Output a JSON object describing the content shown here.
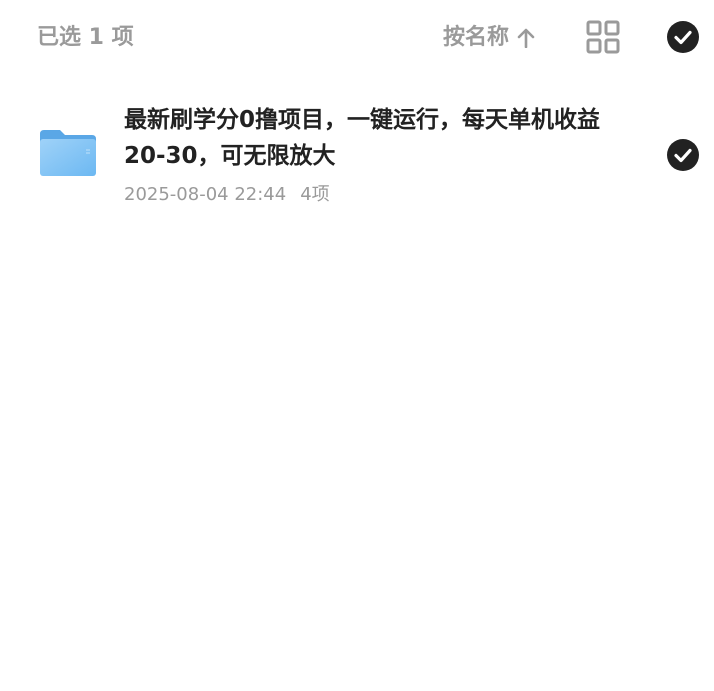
{
  "header": {
    "selected_label": "已选 1 项",
    "sort_label": "按名称",
    "sort_icon": "arrow-up-icon",
    "view_icon": "grid-view-icon",
    "select_all_icon": "check-circle-icon"
  },
  "files": [
    {
      "name": "最新刷学分0撸项目，一键运行，每天单机收益20-30，可无限放大",
      "date": "2025-08-04 22:44",
      "count": "4项",
      "icon": "folder-icon",
      "selected": true
    }
  ],
  "colors": {
    "muted_text": "#9a9a9a",
    "primary_text": "#222222",
    "check_fill": "#222222",
    "folder_blue": "#6cb8f2"
  }
}
